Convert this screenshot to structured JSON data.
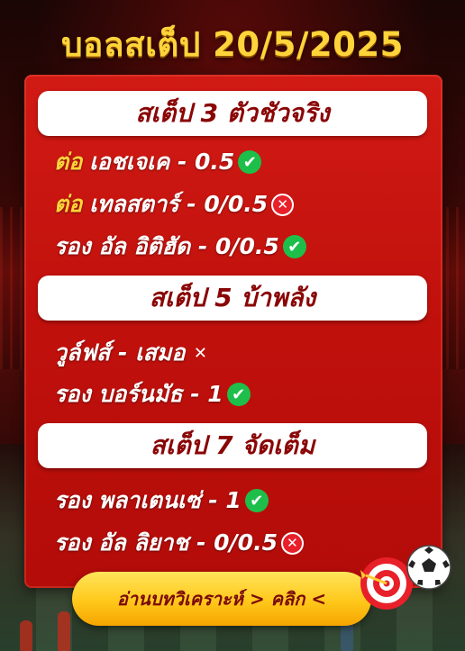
{
  "title": "บอลสเต็ป 20/5/2025",
  "sections": [
    {
      "header": "สเต็ป 3 ตัวชัวจริง",
      "rows": [
        {
          "label": "ต่อ",
          "text": "เอชเจเค - 0.5",
          "result": "win"
        },
        {
          "label": "ต่อ",
          "text": "เทลสตาร์ - 0/0.5",
          "result": "lose"
        },
        {
          "label": "",
          "text": "รอง อัล อิติฮัด - 0/0.5",
          "result": "win"
        }
      ]
    },
    {
      "header": "สเต็ป 5 บ้าพลัง",
      "rows": [
        {
          "label": "",
          "text": "วูล์ฟส์ - เสมอ",
          "result": "lose-plain"
        },
        {
          "label": "",
          "text": "รอง บอร์นมัธ - 1",
          "result": "win"
        }
      ]
    },
    {
      "header": "สเต็ป 7 จัดเต็ม",
      "rows": [
        {
          "label": "",
          "text": "รอง พลาเตนเซ่ - 1",
          "result": "win"
        },
        {
          "label": "",
          "text": "รอง อัล ลิยาช - 0/0.5",
          "result": "lose"
        }
      ]
    }
  ],
  "cta_label": "อ่านบทวิเคราะห์ > คลิก <",
  "icons": {
    "win": "check-circle-icon",
    "lose": "x-circle-icon",
    "lose_plain": "x-mark-icon",
    "decor_target": "dartboard-icon",
    "decor_ball": "soccer-ball-icon"
  },
  "colors": {
    "accent": "#ffd43a",
    "panel": "#c0100c",
    "header_text": "#8a0606",
    "win": "#1dbf4a",
    "lose": "#e8202a"
  }
}
